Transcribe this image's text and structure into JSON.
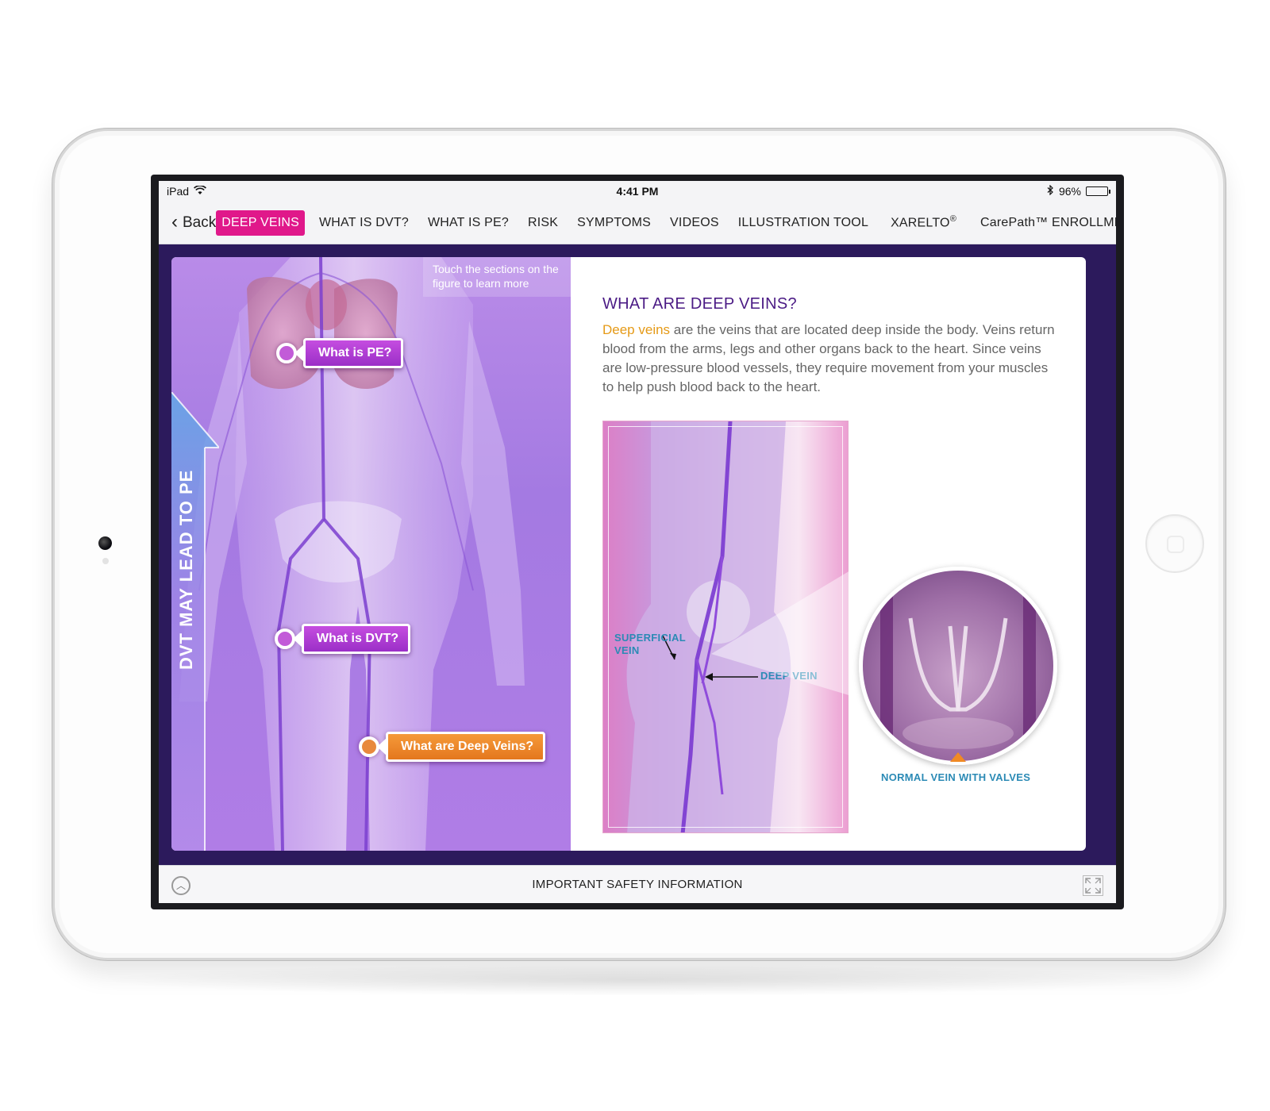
{
  "statusbar": {
    "device": "iPad",
    "time": "4:41 PM",
    "battery": "96%",
    "battery_level": 0.96
  },
  "nav": {
    "back": "Back",
    "items": [
      "DEEP VEINS",
      "WHAT IS DVT?",
      "WHAT IS PE?",
      "RISK",
      "SYMPTOMS",
      "VIDEOS",
      "ILLUSTRATION TOOL",
      "XARELTO",
      "CarePath™ ENROLLMENT"
    ],
    "active": "DEEP VEINS",
    "registered_mark": "®"
  },
  "figure": {
    "hint": "Touch the sections on the figure to learn more",
    "arrow_label": "DVT MAY LEAD TO PE",
    "tags": {
      "pe": "What is PE?",
      "dvt": "What is DVT?",
      "deep": "What are Deep Veins?"
    }
  },
  "article": {
    "heading": "WHAT ARE DEEP VEINS?",
    "highlight": "Deep veins",
    "body": " are the veins that are located deep inside the body. Veins return blood from the arms, legs and other organs back to the heart. Since veins are low-pressure blood vessels, they require movement from your muscles to help push blood back to the heart."
  },
  "diagram": {
    "superficial_line1": "SUPERFICIAL",
    "superficial_line2": "VEIN",
    "deep": "DEEP VEIN",
    "normal": "NORMAL VEIN WITH VALVES"
  },
  "footer": {
    "title": "IMPORTANT SAFETY INFORMATION"
  },
  "colors": {
    "accent": "#e0188a",
    "heading": "#4b1b85",
    "highlight": "#e59a17",
    "callout": "#2b8ab5",
    "frame": "#2c1a5c"
  }
}
